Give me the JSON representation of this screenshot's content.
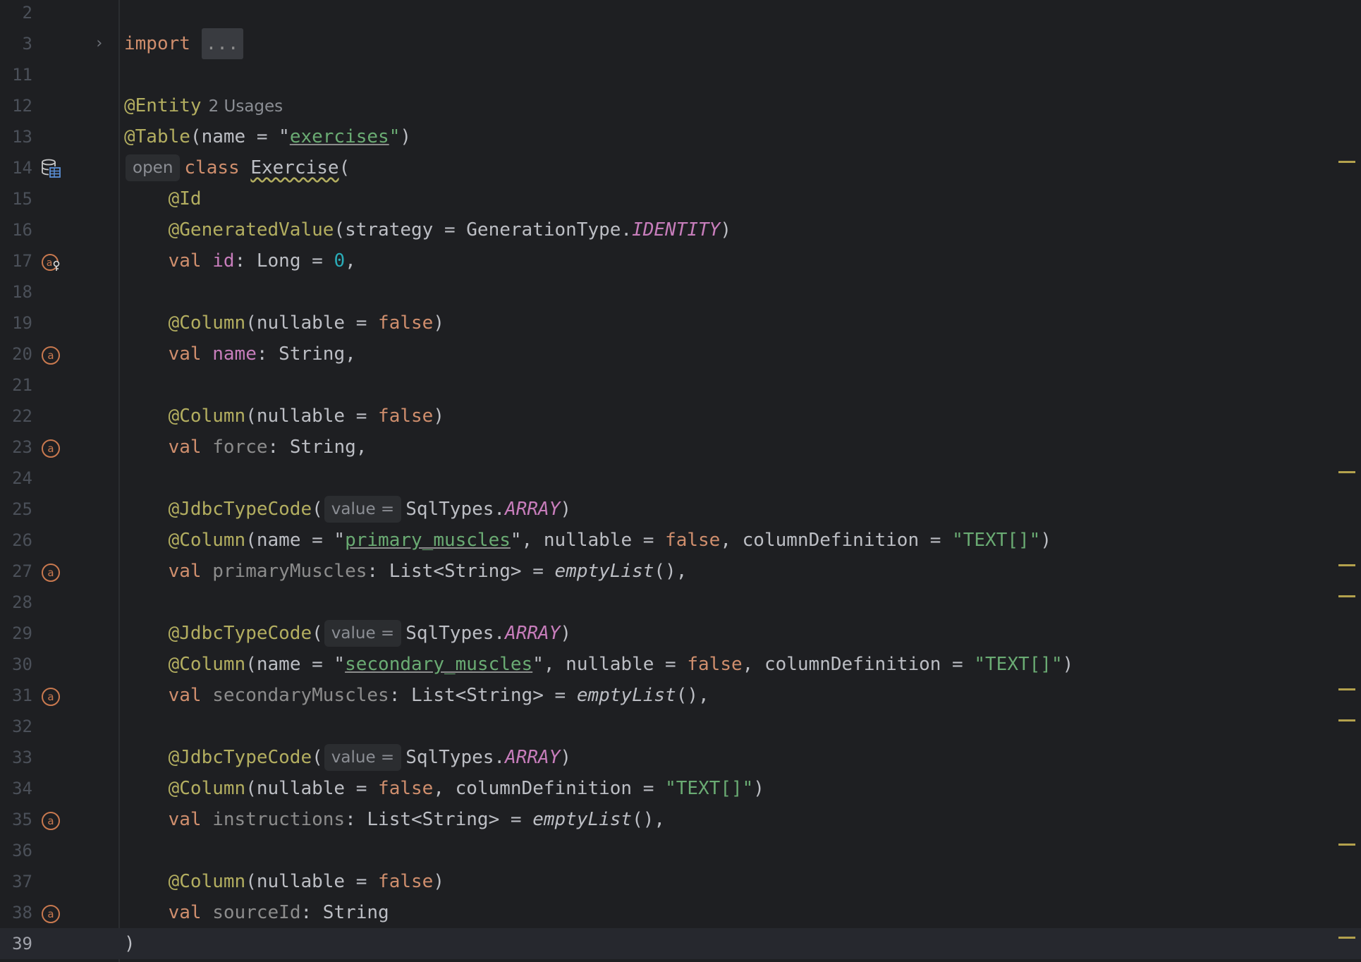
{
  "editor": {
    "language": "Kotlin",
    "current_line": "39",
    "lines": [
      {
        "n": "2",
        "tokens": []
      },
      {
        "n": "3",
        "fold": true,
        "tokens": [
          [
            "kw",
            "import "
          ],
          [
            "fold",
            "..."
          ]
        ]
      },
      {
        "n": "11",
        "tokens": []
      },
      {
        "n": "12",
        "tokens": [
          [
            "ann",
            "@Entity"
          ],
          [
            "usages",
            "2 Usages"
          ]
        ]
      },
      {
        "n": "13",
        "tokens": [
          [
            "ann",
            "@Table"
          ],
          [
            "p",
            "(name = \""
          ],
          [
            "str-ul",
            "exercises"
          ],
          [
            "str",
            "\""
          ],
          [
            "p",
            ")"
          ]
        ]
      },
      {
        "n": "14",
        "icon": "database-table-icon",
        "tokens": [
          [
            "hint",
            "open"
          ],
          [
            "kw",
            "class "
          ],
          [
            "squig",
            "Exercise"
          ],
          [
            "p",
            "("
          ]
        ]
      },
      {
        "n": "15",
        "tokens": [
          [
            "p",
            "    "
          ],
          [
            "ann",
            "@Id"
          ]
        ]
      },
      {
        "n": "16",
        "tokens": [
          [
            "p",
            "    "
          ],
          [
            "ann",
            "@GeneratedValue"
          ],
          [
            "p",
            "(strategy = GenerationType."
          ],
          [
            "const",
            "IDENTITY"
          ],
          [
            "p",
            ")"
          ]
        ]
      },
      {
        "n": "17",
        "icon": "primary-key-icon",
        "tokens": [
          [
            "p",
            "    "
          ],
          [
            "kw",
            "val "
          ],
          [
            "prop",
            "id"
          ],
          [
            "p",
            ": Long = "
          ],
          [
            "num",
            "0"
          ],
          [
            "p",
            ","
          ]
        ]
      },
      {
        "n": "18",
        "tokens": []
      },
      {
        "n": "19",
        "tokens": [
          [
            "p",
            "    "
          ],
          [
            "ann",
            "@Column"
          ],
          [
            "p",
            "(nullable = "
          ],
          [
            "kw",
            "false"
          ],
          [
            "p",
            ")"
          ]
        ]
      },
      {
        "n": "20",
        "icon": "attribute-icon",
        "tokens": [
          [
            "p",
            "    "
          ],
          [
            "kw",
            "val "
          ],
          [
            "prop",
            "name"
          ],
          [
            "p",
            ": String,"
          ]
        ]
      },
      {
        "n": "21",
        "tokens": []
      },
      {
        "n": "22",
        "tokens": [
          [
            "p",
            "    "
          ],
          [
            "ann",
            "@Column"
          ],
          [
            "p",
            "(nullable = "
          ],
          [
            "kw",
            "false"
          ],
          [
            "p",
            ")"
          ]
        ]
      },
      {
        "n": "23",
        "icon": "attribute-icon",
        "tokens": [
          [
            "p",
            "    "
          ],
          [
            "kw",
            "val "
          ],
          [
            "unused",
            "force"
          ],
          [
            "p",
            ": String,"
          ]
        ]
      },
      {
        "n": "24",
        "tokens": []
      },
      {
        "n": "25",
        "tokens": [
          [
            "p",
            "    "
          ],
          [
            "ann",
            "@JdbcTypeCode"
          ],
          [
            "p",
            "("
          ],
          [
            "hint",
            "value ="
          ],
          [
            "p",
            "SqlTypes."
          ],
          [
            "const",
            "ARRAY"
          ],
          [
            "p",
            ")"
          ]
        ]
      },
      {
        "n": "26",
        "tokens": [
          [
            "p",
            "    "
          ],
          [
            "ann",
            "@Column"
          ],
          [
            "p",
            "(name = \""
          ],
          [
            "str-ul",
            "primary_muscles"
          ],
          [
            "p",
            "\", nullable = "
          ],
          [
            "kw",
            "false"
          ],
          [
            "p",
            ", columnDefinition = "
          ],
          [
            "str",
            "\"TEXT[]\""
          ],
          [
            "p",
            ")"
          ]
        ]
      },
      {
        "n": "27",
        "icon": "attribute-icon",
        "tokens": [
          [
            "p",
            "    "
          ],
          [
            "kw",
            "val "
          ],
          [
            "unused",
            "primaryMuscles"
          ],
          [
            "p",
            ": List<String> = "
          ],
          [
            "fn",
            "emptyList"
          ],
          [
            "p",
            "(),"
          ]
        ]
      },
      {
        "n": "28",
        "tokens": []
      },
      {
        "n": "29",
        "tokens": [
          [
            "p",
            "    "
          ],
          [
            "ann",
            "@JdbcTypeCode"
          ],
          [
            "p",
            "("
          ],
          [
            "hint",
            "value ="
          ],
          [
            "p",
            "SqlTypes."
          ],
          [
            "const",
            "ARRAY"
          ],
          [
            "p",
            ")"
          ]
        ]
      },
      {
        "n": "30",
        "tokens": [
          [
            "p",
            "    "
          ],
          [
            "ann",
            "@Column"
          ],
          [
            "p",
            "(name = \""
          ],
          [
            "str-ul",
            "secondary_muscles"
          ],
          [
            "p",
            "\", nullable = "
          ],
          [
            "kw",
            "false"
          ],
          [
            "p",
            ", columnDefinition = "
          ],
          [
            "str",
            "\"TEXT[]\""
          ],
          [
            "p",
            ")"
          ]
        ]
      },
      {
        "n": "31",
        "icon": "attribute-icon",
        "tokens": [
          [
            "p",
            "    "
          ],
          [
            "kw",
            "val "
          ],
          [
            "unused",
            "secondaryMuscles"
          ],
          [
            "p",
            ": List<String> = "
          ],
          [
            "fn",
            "emptyList"
          ],
          [
            "p",
            "(),"
          ]
        ]
      },
      {
        "n": "32",
        "tokens": []
      },
      {
        "n": "33",
        "tokens": [
          [
            "p",
            "    "
          ],
          [
            "ann",
            "@JdbcTypeCode"
          ],
          [
            "p",
            "("
          ],
          [
            "hint",
            "value ="
          ],
          [
            "p",
            "SqlTypes."
          ],
          [
            "const",
            "ARRAY"
          ],
          [
            "p",
            ")"
          ]
        ]
      },
      {
        "n": "34",
        "tokens": [
          [
            "p",
            "    "
          ],
          [
            "ann",
            "@Column"
          ],
          [
            "p",
            "(nullable = "
          ],
          [
            "kw",
            "false"
          ],
          [
            "p",
            ", columnDefinition = "
          ],
          [
            "str",
            "\"TEXT[]\""
          ],
          [
            "p",
            ")"
          ]
        ]
      },
      {
        "n": "35",
        "icon": "attribute-icon",
        "tokens": [
          [
            "p",
            "    "
          ],
          [
            "kw",
            "val "
          ],
          [
            "unused",
            "instructions"
          ],
          [
            "p",
            ": List<String> = "
          ],
          [
            "fn",
            "emptyList"
          ],
          [
            "p",
            "(),"
          ]
        ]
      },
      {
        "n": "36",
        "tokens": []
      },
      {
        "n": "37",
        "tokens": [
          [
            "p",
            "    "
          ],
          [
            "ann",
            "@Column"
          ],
          [
            "p",
            "(nullable = "
          ],
          [
            "kw",
            "false"
          ],
          [
            "p",
            ")"
          ]
        ]
      },
      {
        "n": "38",
        "icon": "attribute-icon",
        "tokens": [
          [
            "p",
            "    "
          ],
          [
            "kw",
            "val "
          ],
          [
            "unused",
            "sourceId"
          ],
          [
            "p",
            ": String"
          ]
        ]
      },
      {
        "n": "39",
        "tokens": [
          [
            "p",
            ")"
          ]
        ]
      }
    ],
    "scrollbar_markers_at_lines": [
      "14",
      "24",
      "27",
      "28",
      "31",
      "32",
      "36",
      "39"
    ]
  },
  "colors": {
    "background": "#1e1f22",
    "keyword": "#cf8e6d",
    "annotation": "#b3ae60",
    "string": "#6aab73",
    "number": "#2aacb8",
    "property": "#c77dbb",
    "warning_marker": "#b3a14d"
  }
}
